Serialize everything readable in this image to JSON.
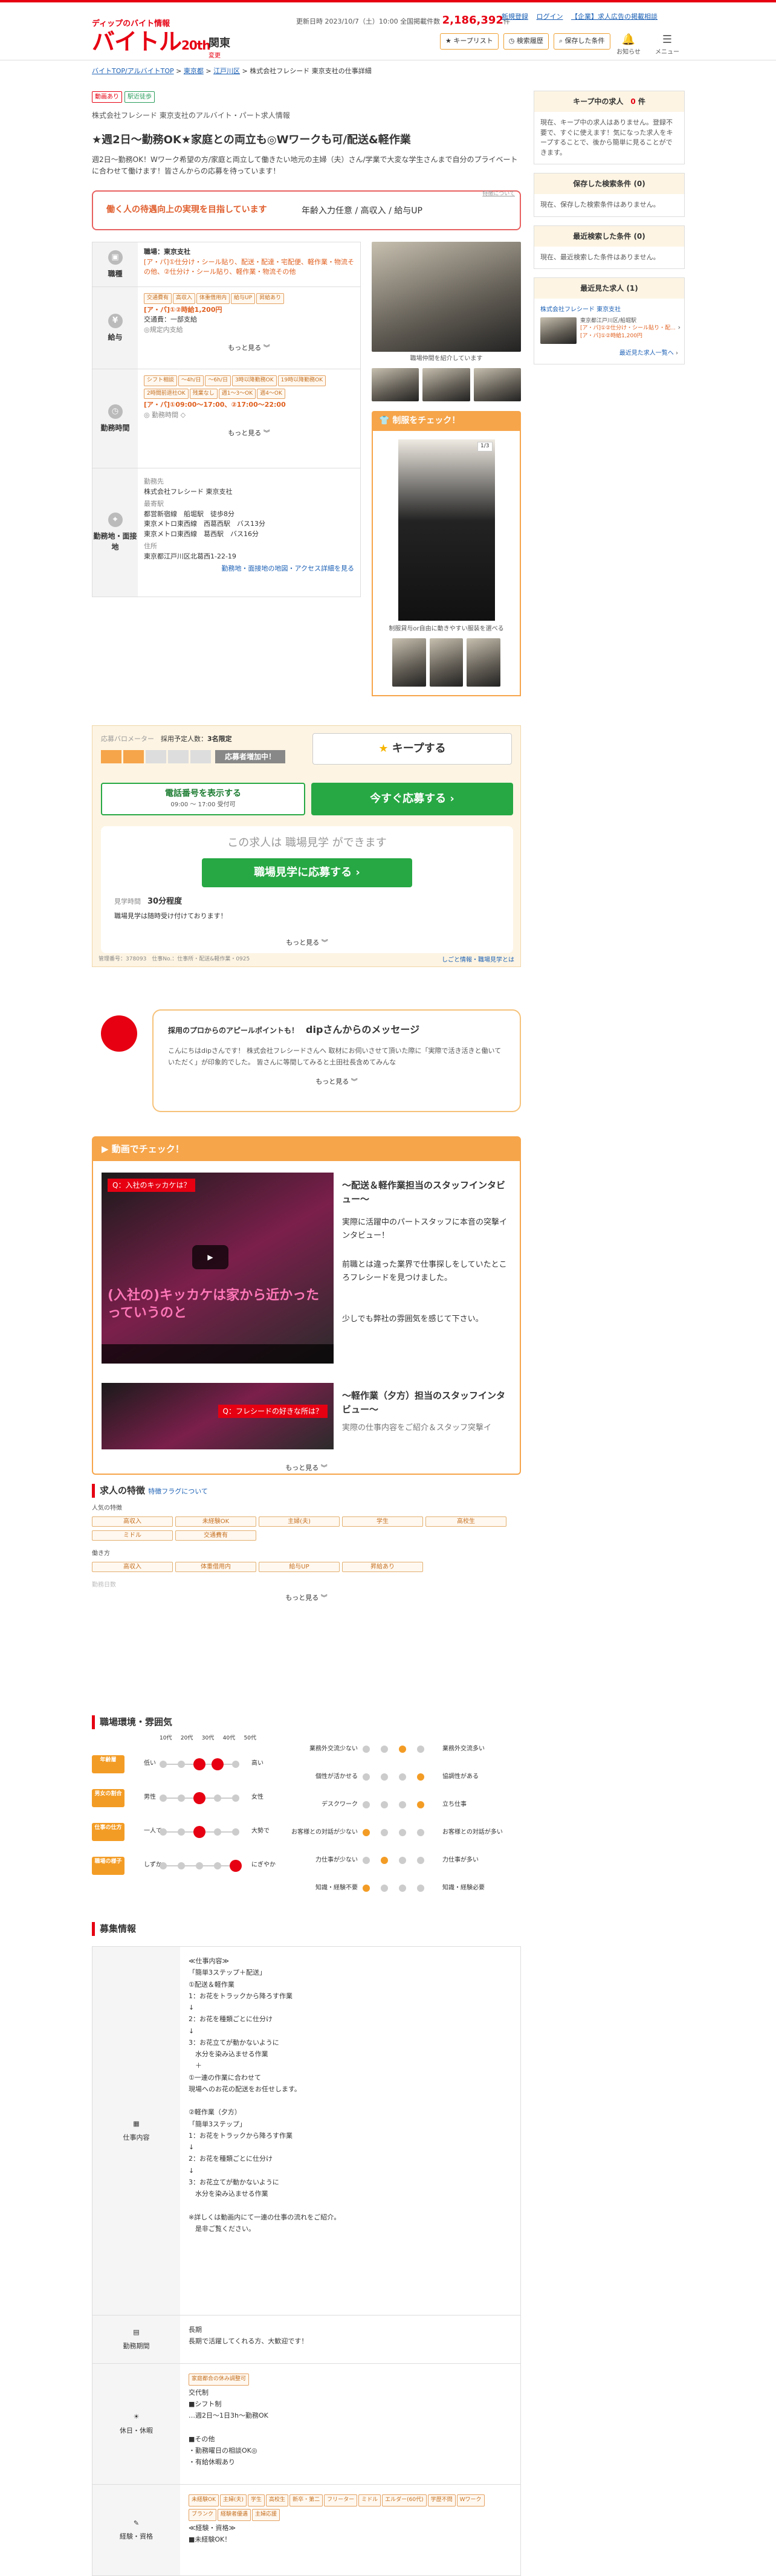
{
  "header": {
    "logo_sub": "ディップのバイト情報",
    "logo_main": "バイトル",
    "logo_badge": "20th",
    "area": "関東",
    "area_change": "変更",
    "update_label": "更新日時",
    "update_date": "2023/10/7（土）10:00 全国掲載件数",
    "count": "2,186,392",
    "count_unit": "件",
    "link_signup": "新規登録",
    "link_login": "ログイン",
    "link_corp": "【企業】求人広告の掲載相談",
    "btn_keep": "キープリスト",
    "btn_history": "検索履歴",
    "btn_saved": "保存した条件",
    "icon_notice": "お知らせ",
    "icon_menu": "メニュー"
  },
  "breadcrumb": [
    "バイトTOP/アルバイトTOP",
    "東京都",
    "江戸川区",
    "株式会社フレシード 東京支社の仕事詳細"
  ],
  "job": {
    "tags": [
      "動画あり",
      "駅近徒歩"
    ],
    "company": "株式会社フレシード 東京支社のアルバイト・パート求人情報",
    "title": "★週2日～勤務OK★家庭との両立も◎Wワークも可/配送&軽作業",
    "lead": "週2日～勤務OK！Wワーク希望の方/家庭と両立して働きたい地元の主婦（夫）さん/学業で大変な学生さんまで自分のプライベートに合わせて働けます！皆さんからの応募を待っています！",
    "catch_left": "働く人の待遇向上の実現を目指しています",
    "catch_right": "年齢入力任意 / 高収入 / 給与UP",
    "catch_small": "特徴について"
  },
  "info": {
    "job_head": "職種",
    "job_company": "職場：東京支社",
    "job_text": "[ア・パ]①仕分け・シール貼り、配送・配達・宅配便、軽作業・物流その他、②仕分け・シール貼り、軽作業・物流その他",
    "pay_head": "給与",
    "pay_chips": [
      "交通費有",
      "高収入",
      "体重借用内",
      "給与UP",
      "昇給あり"
    ],
    "pay_text": "[ア・パ]①②時給1,200円",
    "pay_sub": "交通費：一部支給",
    "pay_sub2": "◎規定内支給",
    "more": "もっと見る",
    "time_head": "勤務時間",
    "time_chips": [
      "シフト相談",
      "〜4h/日",
      "〜6h/日",
      "3時以降勤務OK",
      "19時以降勤務OK",
      "2時間前退社OK",
      "残業なし",
      "週1〜3〜OK",
      "週4〜OK"
    ],
    "time_text": "[ア・パ]①09:00〜17:00、②17:00〜22:00",
    "time_sub": "◎ 勤務時間 ◇",
    "place_head": "勤務地・面接地",
    "place_company_label": "勤務先",
    "place_company": "株式会社フレシード 東京支社",
    "place_station_label": "最寄駅",
    "place_stations": "都営新宿線　船堀駅　徒歩8分\n東京メトロ東西線　西葛西駅　バス13分\n東京メトロ東西線　葛西駅　バス16分",
    "place_addr_label": "住所",
    "place_addr": "東京都江戸川区北葛西1-22-19",
    "place_map": "勤務地・面接地の地図・アクセス詳細を見る"
  },
  "photos": {
    "caption1": "職場仲間を紹介しています",
    "uniform_title": "制服をチェック！",
    "counter": "1/3",
    "caption2": "制服貸与or自由に動きやすい服装を選べる"
  },
  "apply": {
    "meter": "応募バロメーター",
    "plan_label": "採用予定人数：",
    "plan_value": "3名限定",
    "status": "応募者増加中！",
    "keep": "キープする",
    "tel_main": "電話番号を表示する",
    "tel_sub": "09:00 〜 17:00 受付可",
    "now": "今すぐ応募する",
    "visit_lead": "この求人は 職場見学 ができます",
    "visit_btn": "職場見学に応募する",
    "visit_time_label": "見学時間",
    "visit_time": "30分程度",
    "visit_note": "職場見学は随時受け付けております！",
    "more": "もっと見る",
    "code": "管理番号：378093　仕事No.：仕事所・配送&軽作業・0925",
    "link": "しごと情報・職場見学とは"
  },
  "message": {
    "lead": "採用のプロからのアピールポイントも！",
    "name": "dipさんからのメッセージ",
    "body": "こんにちはdipさんです！ 株式会社フレシードさんへ 取材にお伺いさせて頂いた際に「実際で活き活きと働いていただく」が印象的でした。 皆さんに等間してみると土田社長含めてみんな",
    "more": "もっと見る"
  },
  "video": {
    "header": "動画でチェック！",
    "v1_caption_top": "Q：入社のキッカケは？",
    "v1_caption_main": "(入社の)キッカケは家から近かったっていうのと",
    "v1_title": "～配送＆軽作業担当のスタッフインタビュー～",
    "v1_text1": "実際に活躍中のパートスタッフに本音の突撃インタビュー！",
    "v1_text2": "前職とは違った業界で仕事探しをしていたところフレシードを見つけました。",
    "v1_text3": "少しでも弊社の雰囲気を感じて下さい。",
    "v2_caption_top": "Q：フレシードの好きな所は？",
    "v2_title": "～軽作業（夕方）担当のスタッフインタビュー～",
    "v2_text": "実際の仕事内容をご紹介＆スタッフ突撃イ",
    "more": "もっと見る"
  },
  "features": {
    "title": "求人の特徴",
    "link": "特徴フラグについて",
    "g1": "人気の特徴",
    "g1_chips": [
      "高収入",
      "未経験OK",
      "主婦(夫)",
      "学生",
      "高校生",
      "ミドル",
      "交通費有"
    ],
    "g2": "働き方",
    "g2_chips": [
      "高収入",
      "体重借用内",
      "給与UP",
      "昇給あり"
    ],
    "g3": "勤務日数",
    "more": "もっと見る"
  },
  "env": {
    "title": "職場環境・雰囲気",
    "ages": [
      "10代",
      "20代",
      "30代",
      "40代",
      "50代"
    ],
    "rows": [
      {
        "label": "年齢層",
        "left": "低い",
        "right": "高い",
        "on": [
          2,
          3
        ]
      },
      {
        "label": "男女の割合",
        "left": "男性",
        "right": "女性",
        "on": [
          2
        ]
      },
      {
        "label": "仕事の仕方",
        "left": "一人で",
        "right": "大勢で",
        "on": [
          2
        ]
      },
      {
        "label": "職場の様子",
        "left": "しずか",
        "right": "にぎやか",
        "on": [
          4
        ]
      }
    ],
    "radar": [
      {
        "l": "業務外交流少ない",
        "r": "業務外交流多い",
        "on": 2
      },
      {
        "l": "個性が活かせる",
        "r": "協調性がある",
        "on": 3
      },
      {
        "l": "デスクワーク",
        "r": "立ち仕事",
        "on": 3
      },
      {
        "l": "お客様との対話が少ない",
        "r": "お客様との対話が多い",
        "on": 0
      },
      {
        "l": "力仕事が少ない",
        "r": "力仕事が多い",
        "on": 1
      },
      {
        "l": "知識・経験不要",
        "r": "知識・経験必要",
        "on": 0
      }
    ]
  },
  "recruit": {
    "title": "募集情報",
    "job_head": "仕事内容",
    "job_body": "≪仕事内容≫\n「簡単3ステップ＋配送」\n①配送＆軽作業\n1：お花をトラックから降ろす作業\n↓\n2：お花を種類ごとに仕分け\n↓\n3：お花立てが動かないように\n　水分を染み込ませる作業\n　＋\n①一連の作業に合わせて\n現場へのお花の配送をお任せします。\n\n②軽作業（夕方）\n「簡単3ステップ」\n1：お花をトラックから降ろす作業\n↓\n2：お花を種類ごとに仕分け\n↓\n3：お花立てが動かないように\n　水分を染み込ませる作業\n\n※詳しくは動画内にて一連の仕事の流れをご紹介。\n　是非ご覧ください。",
    "period_head": "勤務期間",
    "period_body": "長期\n長期で活躍してくれる方、大歓迎です！",
    "holiday_head": "休日・休暇",
    "holiday_chip": "家庭都合の休み調整可",
    "holiday_body": "交代制\n■シフト制\n…週2日〜1日3h〜勤務OK\n\n■その他\n・勤務曜日の相談OK◎\n・有給休暇あり",
    "qual_head": "経験・資格",
    "qual_chips": [
      "未経験OK",
      "主婦(夫)",
      "学生",
      "高校生",
      "新卒・第二",
      "フリーター",
      "ミドル",
      "エルダー(60代)",
      "学歴不問",
      "Wワーク",
      "ブランク",
      "経験者優遇",
      "主婦応援"
    ],
    "qual_body": "≪経験・資格≫\n■未経験OK！"
  },
  "sidebar": {
    "keep_title": "キープ中の求人",
    "keep_count": "0",
    "keep_unit": "件",
    "keep_body": "現在、キープ中の求人はありません。登録不要で、すぐに使えます！気になった求人をキープすることで、後から簡単に見ることができます。",
    "saved_title": "保存した検索条件",
    "saved_count": "(0)",
    "saved_body": "現在、保存した検索条件はありません。",
    "recent_title": "最近検索した条件",
    "recent_count": "(0)",
    "recent_body": "現在、最近検索した条件はありません。",
    "viewed_title": "最近見た求人",
    "viewed_count": "(1)",
    "viewed_company": "株式会社フレシード 東京支社",
    "viewed_place": "東京都江戸川区/船堀駅",
    "viewed_job": "[ア・パ]①②仕分け・シール貼り・配...",
    "viewed_pay": "[ア・パ]①②時給1,200円",
    "viewed_link": "最近見た求人一覧へ"
  },
  "colors": {
    "brand": "#e60012",
    "accent": "#f6a54a",
    "green": "#27a844"
  }
}
